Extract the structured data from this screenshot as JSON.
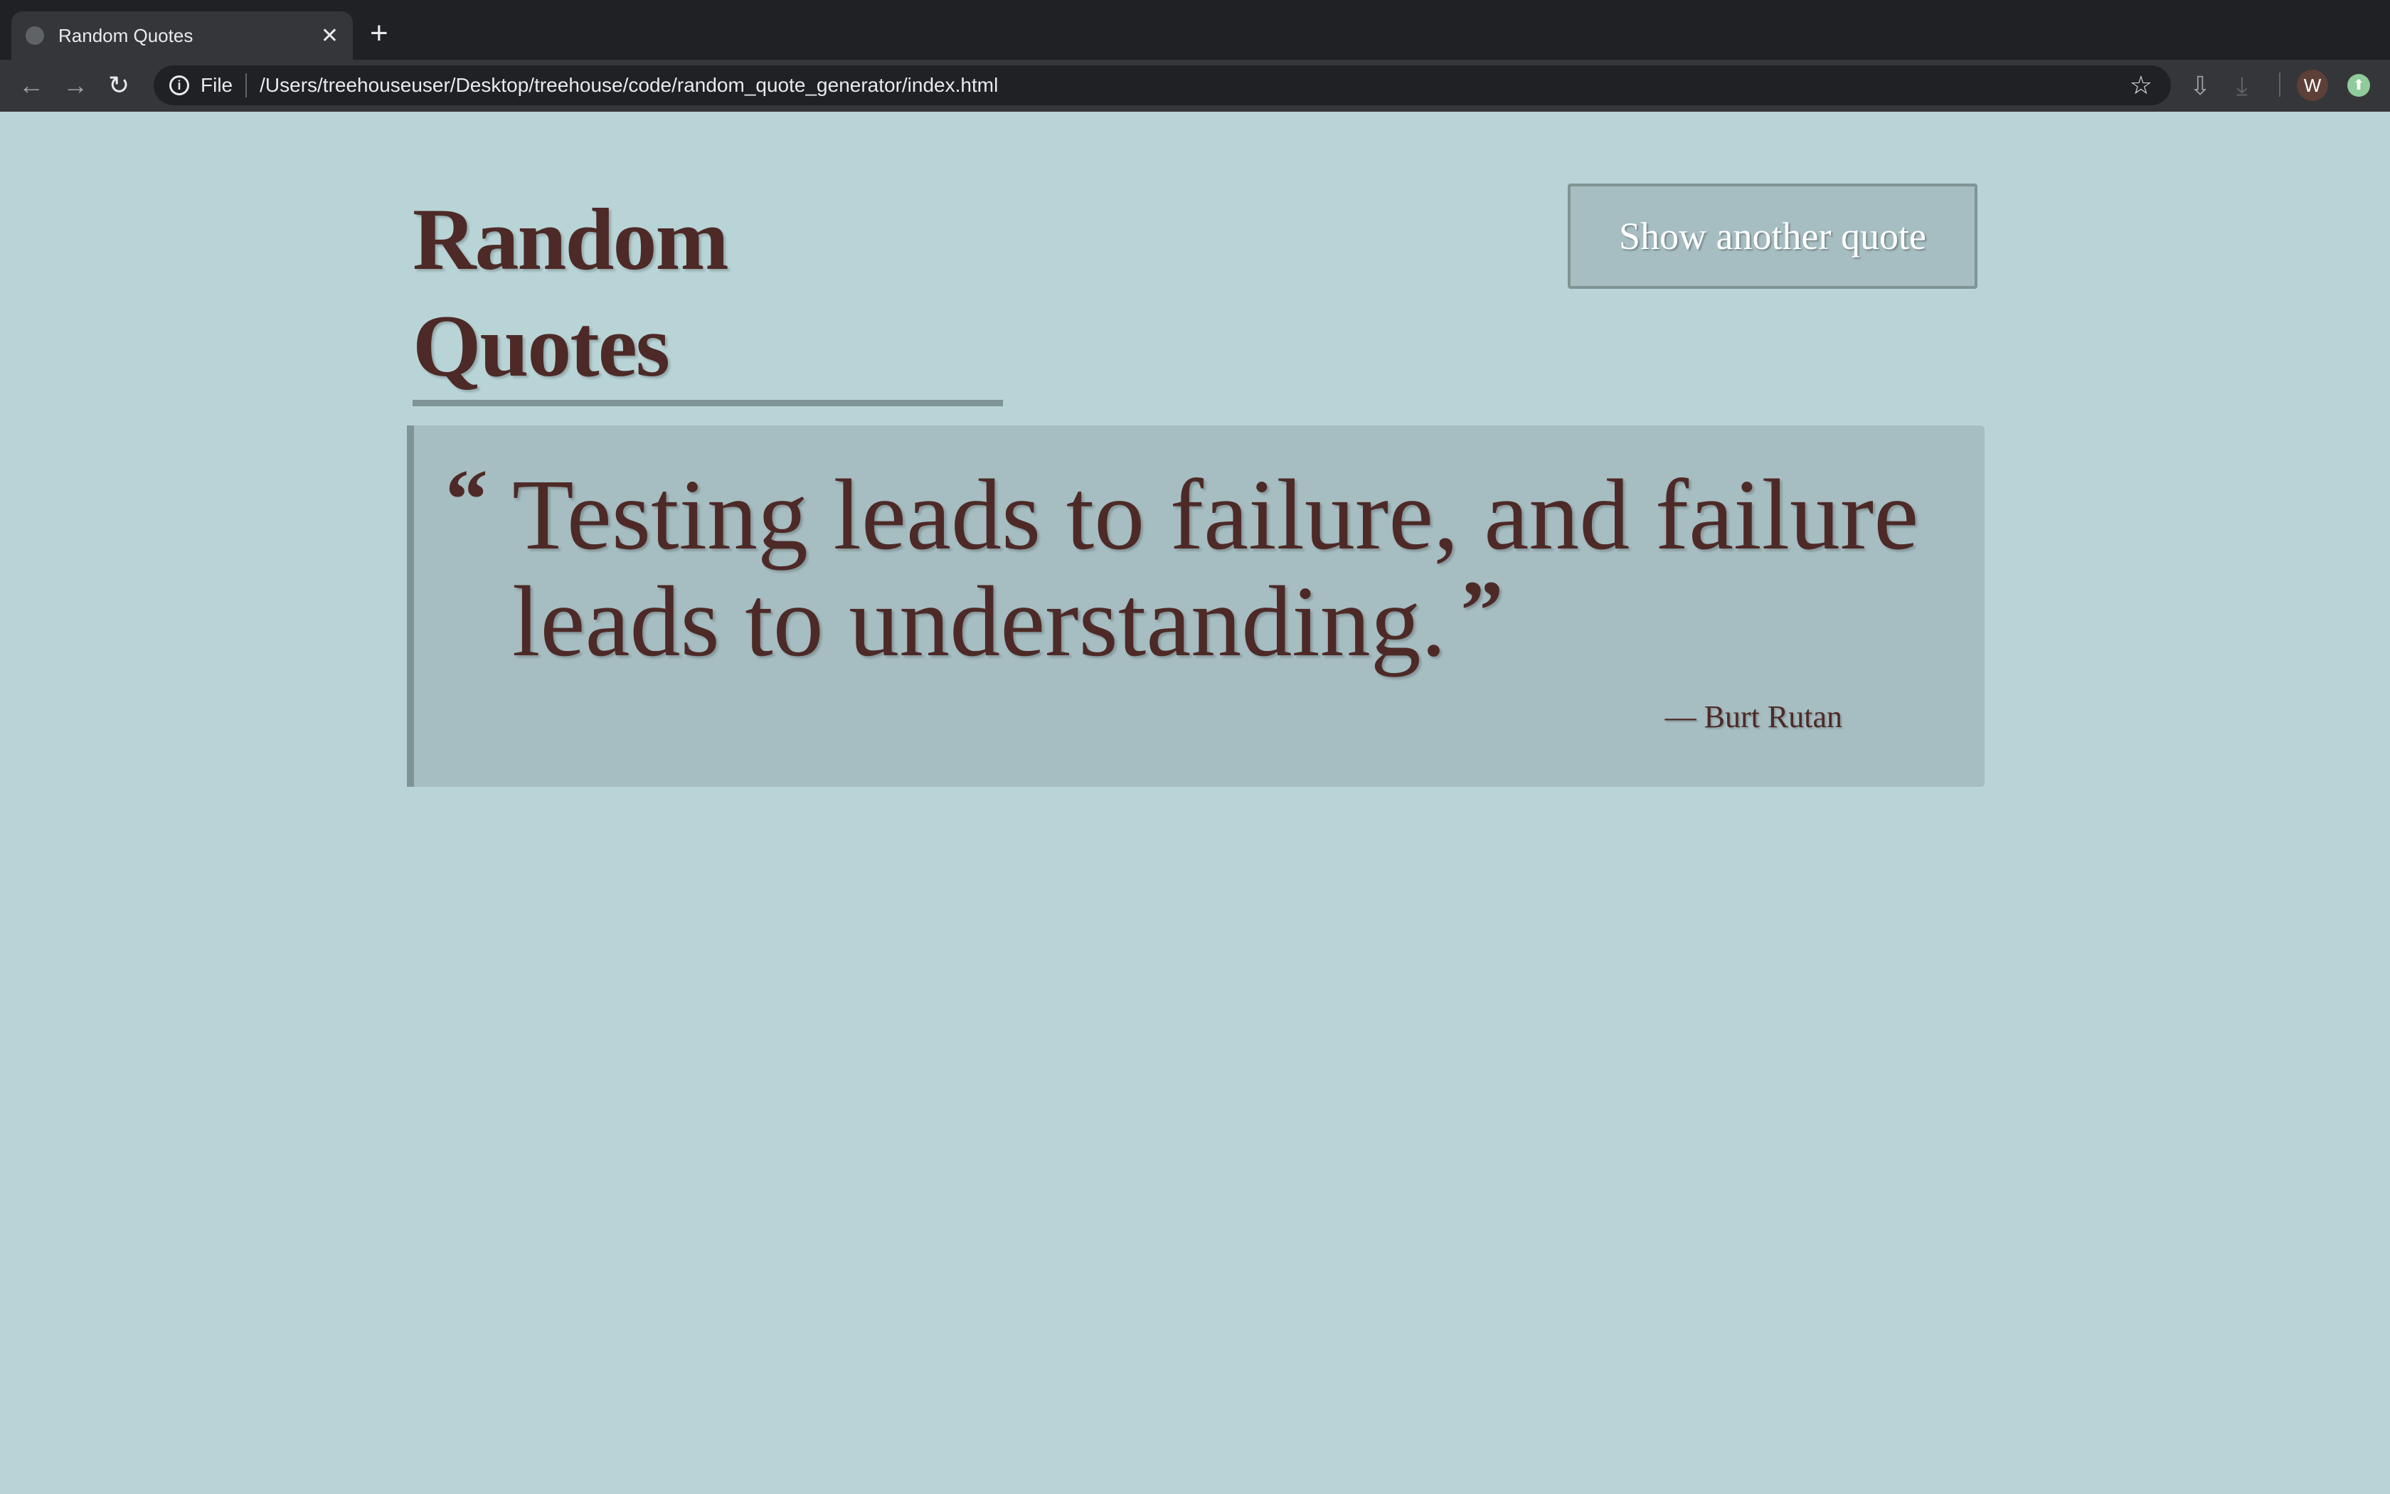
{
  "browser": {
    "tab_title": "Random Quotes",
    "address_scheme": "File",
    "address_url": "/Users/treehouseuser/Desktop/treehouse/code/random_quote_generator/index.html",
    "profile_initial": "W"
  },
  "page": {
    "title": "Random Quotes",
    "button_label": "Show another quote",
    "quote_open": "“",
    "quote_text": "Testing leads to failure, and failure leads to understanding.",
    "quote_close": "”",
    "author": "— Burt Rutan"
  },
  "colors": {
    "background": "#b9d4d7",
    "quote_box": "#a6bdc1",
    "text": "#4d2a27",
    "accent": "#7f9494"
  }
}
